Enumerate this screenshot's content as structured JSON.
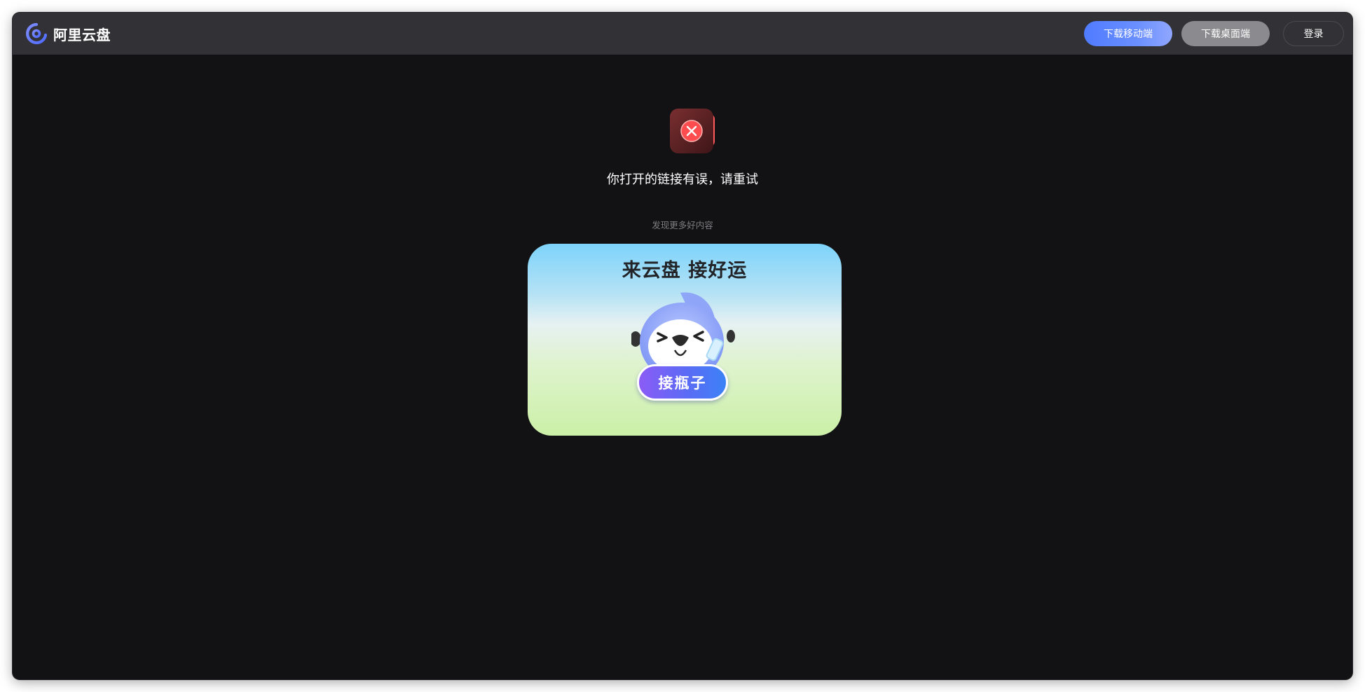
{
  "app": {
    "logo_text": "阿里云盘",
    "logo_icon": "aliyun-drive-logo-icon"
  },
  "header": {
    "download_mobile_label": "下载移动端",
    "download_desktop_label": "下载桌面端",
    "login_label": "登录"
  },
  "main": {
    "error_icon": "error-x-icon",
    "error_message": "你打开的链接有误，请重试",
    "discover_label": "发现更多好内容"
  },
  "promo": {
    "title": "来云盘 接好运",
    "button_label": "接瓶子",
    "mascot_icon": "mascot-icon"
  },
  "colors": {
    "background": "#121214",
    "header": "#323236",
    "accent_blue": "#4f7bff",
    "error_red": "#ff4d4f"
  }
}
